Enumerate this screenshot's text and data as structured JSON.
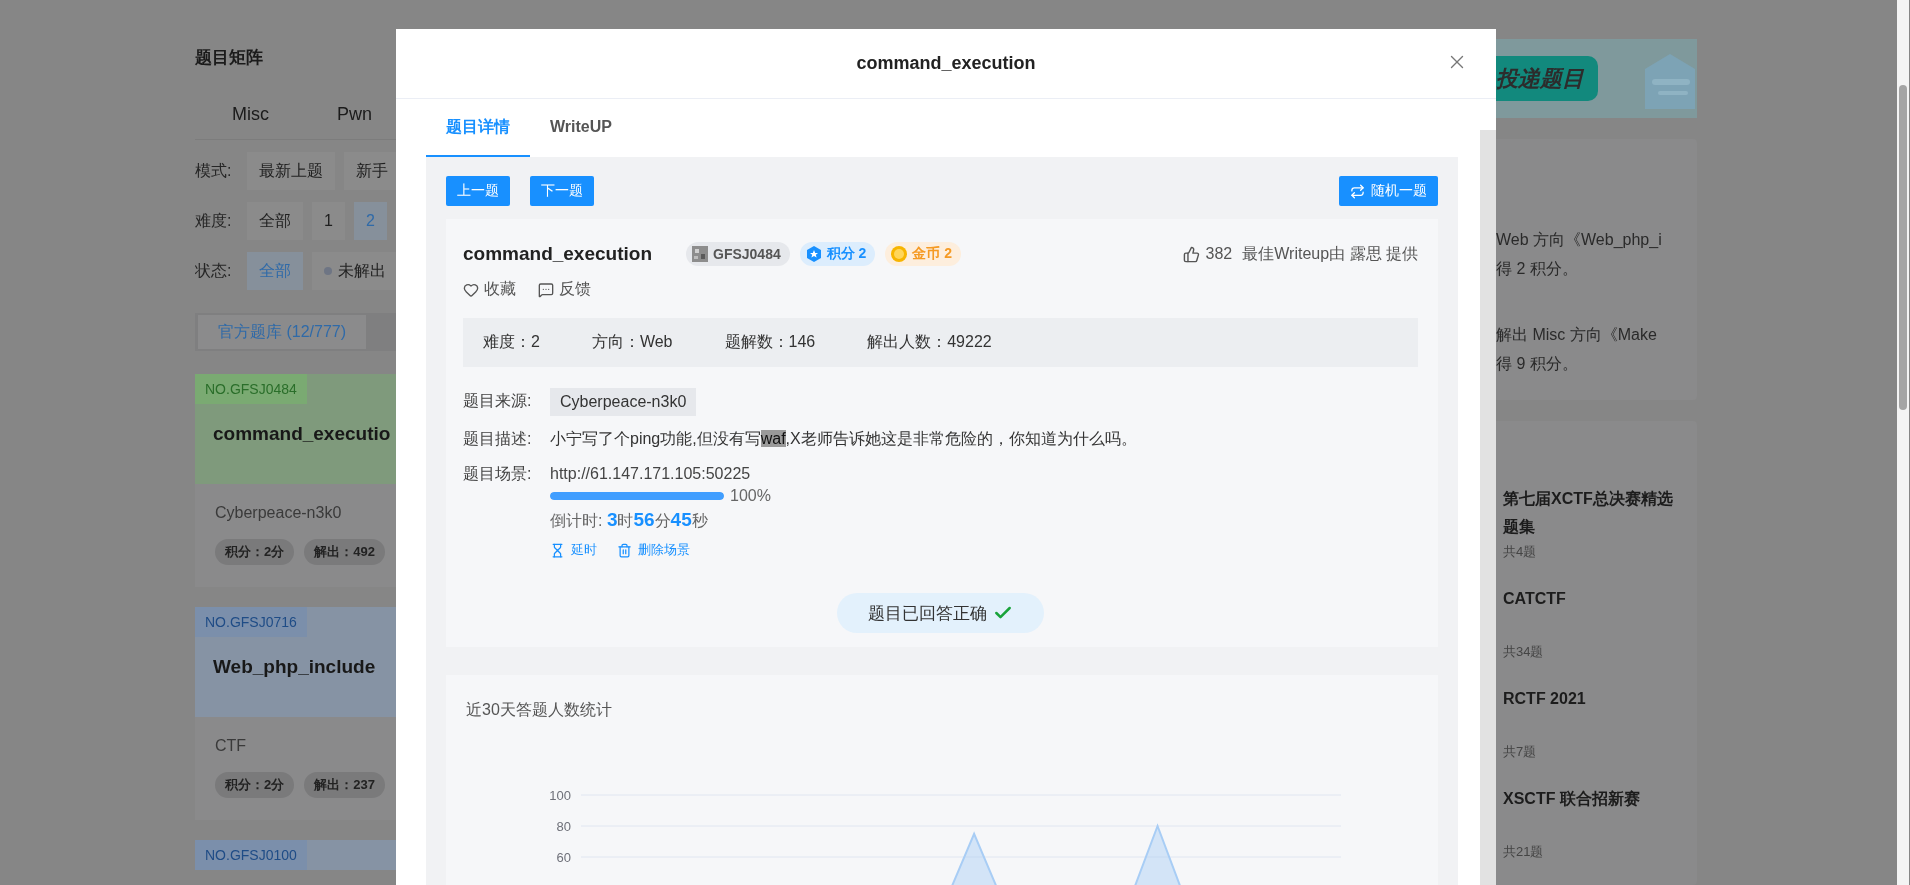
{
  "background_page": {
    "matrix": {
      "title": "题目矩阵",
      "categories": [
        {
          "label": "Misc",
          "selected": false
        },
        {
          "label": "Pwn",
          "selected": false
        }
      ],
      "filters": [
        {
          "label": "模式:",
          "options": [
            {
              "label": "最新上题",
              "selected": false,
              "kind": "plain"
            },
            {
              "label": "新手",
              "selected": false,
              "kind": "plain"
            }
          ]
        },
        {
          "label": "难度:",
          "options": [
            {
              "label": "全部",
              "selected": false,
              "kind": "plain"
            },
            {
              "label": "1",
              "selected": false,
              "kind": "plain"
            },
            {
              "label": "2",
              "selected": true,
              "kind": "plain"
            }
          ]
        },
        {
          "label": "状态:",
          "options": [
            {
              "label": "全部",
              "selected": true,
              "kind": "plain"
            },
            {
              "label": "未解出",
              "selected": false,
              "kind": "dot"
            }
          ]
        }
      ],
      "repo_button": "官方题库 (12/777)",
      "challenges": [
        {
          "number": "NO.GFSJ0484",
          "solved": true,
          "title": "command_executio",
          "source": "Cyberpeace-n3k0",
          "stats": [
            "积分：2分",
            "解出：492"
          ]
        },
        {
          "number": "NO.GFSJ0716",
          "solved": false,
          "title": "Web_php_include",
          "source": "CTF",
          "stats": [
            "积分：2分",
            "解出：237"
          ]
        },
        {
          "number": "NO.GFSJ0100",
          "solved": false
        }
      ]
    },
    "side": {
      "banner": {
        "label": "投递题目"
      },
      "activity": [
        {
          "lines": [
            "Web 方向《Web_php_i",
            "得 2 积分。"
          ]
        },
        {
          "lines": [
            "解出 Misc 方向《Make",
            "得 9 积分。"
          ]
        }
      ],
      "collections": [
        {
          "title": "第七届XCTF总决赛精选题集",
          "count": "共4题"
        },
        {
          "title": "CATCTF",
          "count": "共34题"
        },
        {
          "title": "RCTF 2021",
          "count": "共7题"
        },
        {
          "title": "XSCTF 联合招新赛",
          "count": "共21题"
        }
      ]
    }
  },
  "modal": {
    "title": "command_execution",
    "tabs": [
      {
        "label": "题目详情",
        "selected": true
      },
      {
        "label": "WriteUP",
        "selected": false
      }
    ],
    "nav_buttons": [
      "上一题",
      "下一题"
    ],
    "random_button": "随机一题",
    "challenge": {
      "name": "command_execution",
      "badges": [
        {
          "kind": "id",
          "label": "GFSJ0484"
        },
        {
          "kind": "score",
          "label": "积分 2"
        },
        {
          "kind": "coin",
          "label": "金币 2"
        }
      ],
      "likes": "382",
      "writeup_credit": "最佳Writeup由 露思 提供",
      "actions": [
        {
          "kind": "favorite",
          "label": "收藏"
        },
        {
          "kind": "feedback",
          "label": "反馈"
        }
      ],
      "stats": [
        "难度：2",
        "方向：Web",
        "题解数：146",
        "解出人数：49222"
      ],
      "source_label": "题目来源:",
      "source": "Cyberpeace-n3k0",
      "description_label": "题目描述:",
      "description": {
        "before": "小宁写了个ping功能,但没有写",
        "highlighted": "waf",
        "after": ",X老师告诉她这是非常危险的，你知道为什么吗。"
      },
      "scene_label": "题目场景:",
      "scene_url": "http://61.147.171.105:50225",
      "progress": {
        "level": 1,
        "reading": "100%"
      },
      "countdown": "倒计时: **3**时**56**分**45**秒",
      "scene_actions": [
        {
          "kind": "extend",
          "label": "延时"
        },
        {
          "kind": "delete",
          "label": "删除场景"
        }
      ],
      "answer_status": {
        "solved": true,
        "label": "题目已回答正确"
      }
    },
    "stats_chart": {
      "title": "近30天答题人数统计",
      "chart_data": {
        "type": "area",
        "ylim": [
          0,
          100
        ],
        "yticks": [
          60,
          80,
          100
        ],
        "series": [
          {
            "color": "#a8cdf5",
            "values": [
              35,
              35,
              35,
              35,
              35,
              35,
              35,
              35,
              35,
              35,
              35,
              35,
              35,
              35,
              35,
              75,
              35,
              35,
              35,
              35,
              35,
              35,
              80,
              35,
              35,
              35,
              35,
              35,
              35,
              35
            ]
          }
        ]
      }
    }
  }
}
